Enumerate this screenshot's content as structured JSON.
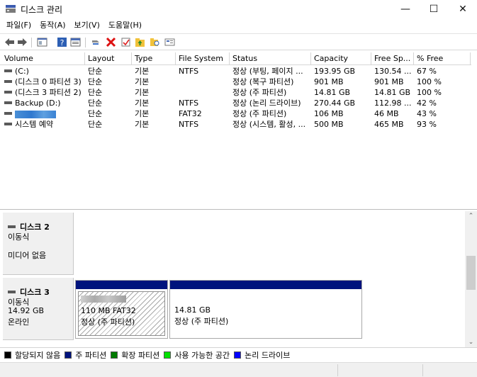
{
  "window": {
    "title": "디스크 관리",
    "minimize": "—",
    "maximize": "☐",
    "close": "✕"
  },
  "menu": [
    "파일(F)",
    "동작(A)",
    "보기(V)",
    "도움말(H)"
  ],
  "toolbar": {
    "icons": [
      "back-arrow-icon",
      "forward-arrow-icon",
      "console-tree-icon",
      "help-icon",
      "properties-icon",
      "connect-icon",
      "delete-icon",
      "check-icon",
      "up-folder-icon",
      "search-folder-icon",
      "view-icon"
    ]
  },
  "list": {
    "columns": [
      "Volume",
      "Layout",
      "Type",
      "File System",
      "Status",
      "Capacity",
      "Free Sp...",
      "% Free"
    ],
    "rows": [
      {
        "volume": "(C:)",
        "layout": "단순",
        "type": "기본",
        "fs": "NTFS",
        "status": "정상 (부팅, 페이지 ...",
        "capacity": "193.95 GB",
        "free": "130.54 ...",
        "pct": "67 %"
      },
      {
        "volume": "(디스크 0 파티션 3)",
        "layout": "단순",
        "type": "기본",
        "fs": "",
        "status": "정상 (복구 파티션)",
        "capacity": "901 MB",
        "free": "901 MB",
        "pct": "100 %"
      },
      {
        "volume": "(디스크 3 파티션 2)",
        "layout": "단순",
        "type": "기본",
        "fs": "",
        "status": "정상 (주 파티션)",
        "capacity": "14.81 GB",
        "free": "14.81 GB",
        "pct": "100 %"
      },
      {
        "volume": "Backup (D:)",
        "layout": "단순",
        "type": "기본",
        "fs": "NTFS",
        "status": "정상 (논리 드라이브)",
        "capacity": "270.44 GB",
        "free": "112.98 ...",
        "pct": "42 %"
      },
      {
        "volume": "",
        "layout": "단순",
        "type": "기본",
        "fs": "FAT32",
        "status": "정상 (주 파티션)",
        "capacity": "106 MB",
        "free": "46 MB",
        "pct": "43 %"
      },
      {
        "volume": "시스템 예약",
        "layout": "단순",
        "type": "기본",
        "fs": "NTFS",
        "status": "정상 (시스템, 활성, ...",
        "capacity": "500 MB",
        "free": "465 MB",
        "pct": "93 %"
      }
    ]
  },
  "disks": [
    {
      "name": "디스크 2",
      "lines": [
        "이동식",
        "미디어 없음"
      ]
    },
    {
      "name": "디스크 3",
      "lines": [
        "이동식",
        "14.92 GB",
        "온라인"
      ],
      "partitions": [
        {
          "size": "110 MB FAT32",
          "status": "정상 (주 파티션)"
        },
        {
          "size": "14.81 GB",
          "status": "정상 (주 파티션)"
        }
      ]
    }
  ],
  "legend": [
    {
      "label": "할당되지 않음",
      "color": "#000000"
    },
    {
      "label": "주 파티션",
      "color": "#00137d"
    },
    {
      "label": "확장 파티션",
      "color": "#007a00"
    },
    {
      "label": "사용 가능한 공간",
      "color": "#00e000"
    },
    {
      "label": "논리 드라이브",
      "color": "#0000ff"
    }
  ]
}
